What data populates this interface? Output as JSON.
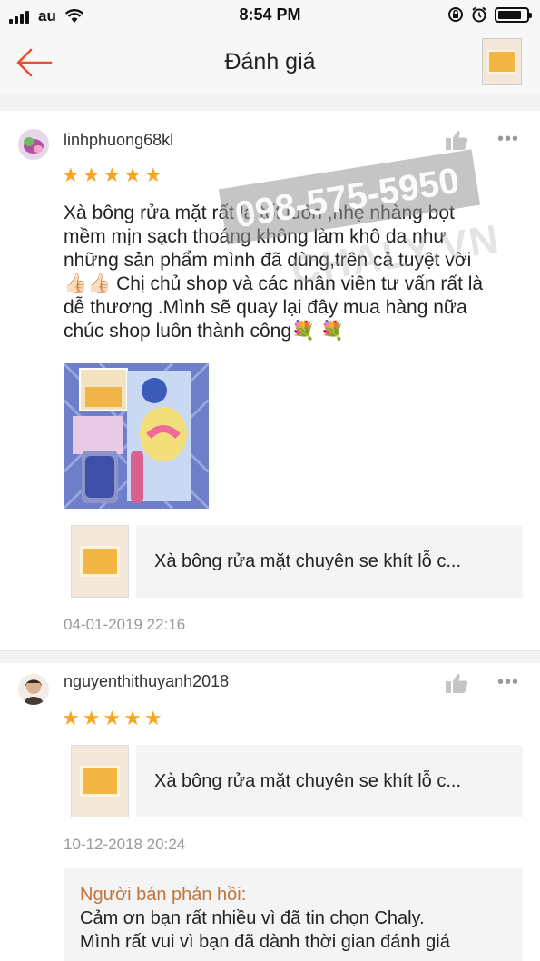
{
  "status_bar": {
    "carrier": "au",
    "time": "8:54 PM"
  },
  "header": {
    "title": "Đánh giá",
    "back_icon": "arrow-left-icon",
    "accent_color": "#ee4d2d"
  },
  "watermark": {
    "phone": "098-575-5950",
    "site": "CHALY.VN"
  },
  "reviews": [
    {
      "username": "linhphuong68kl",
      "rating": 5,
      "comment_lines": [
        "Xà bông rửa mặt rất là tốt luôn ,nhẹ nhàng bọt",
        "mềm mịn sạch thoáng không làm khô da như",
        "những sản phẩm mình đã dùng,trên cả tuyệt vời",
        "👍🏻👍🏻 Chị chủ shop và các nhân viên tư vấn rất là",
        "dễ thương .Mình sẽ quay lại đây mua hàng nữa",
        "chúc shop luôn thành công💐 💐"
      ],
      "product_name": "Xà bông rửa mặt chuyên se khít lỗ c...",
      "date": "04-01-2019 22:16"
    },
    {
      "username": "nguyenthithuyanh2018",
      "rating": 5,
      "product_name": "Xà bông rửa mặt chuyên se khít lỗ c...",
      "date": "10-12-2018 20:24",
      "seller_reply": {
        "title": "Người bán phản hồi:",
        "lines": [
          "Cảm ơn bạn rất nhiều vì đã tin chọn Chaly.",
          "Mình rất vui vì bạn đã dành thời gian đánh giá"
        ]
      }
    }
  ]
}
